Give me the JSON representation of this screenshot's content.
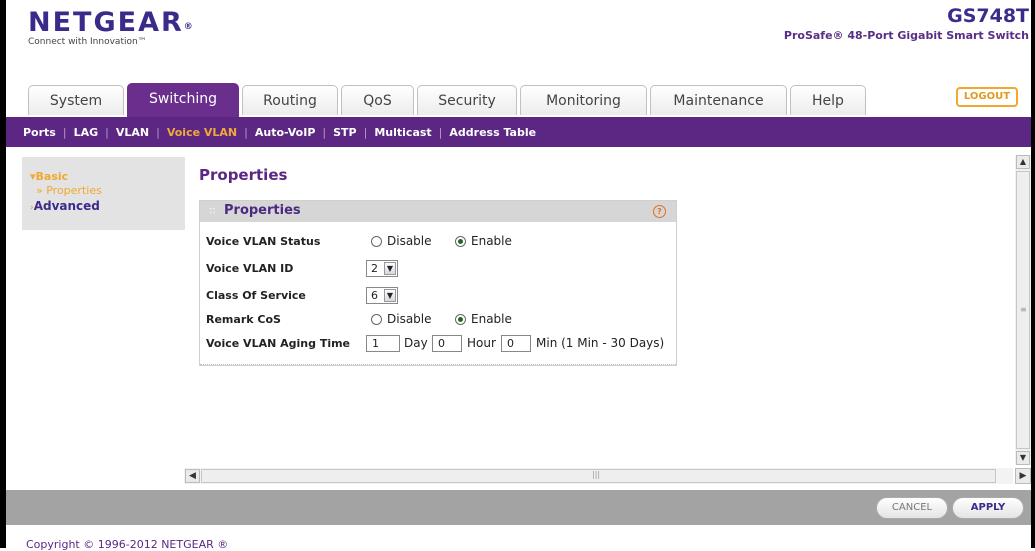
{
  "brand": {
    "logo": "NETGEAR",
    "logo_mark": "®",
    "tagline": "Connect with Innovation™"
  },
  "model": {
    "name": "GS748T",
    "description": "ProSafe® 48-Port Gigabit Smart Switch"
  },
  "tabs": [
    {
      "label": "System",
      "active": false
    },
    {
      "label": "Switching",
      "active": true
    },
    {
      "label": "Routing",
      "active": false
    },
    {
      "label": "QoS",
      "active": false
    },
    {
      "label": "Security",
      "active": false
    },
    {
      "label": "Monitoring",
      "active": false
    },
    {
      "label": "Maintenance",
      "active": false
    },
    {
      "label": "Help",
      "active": false
    }
  ],
  "logout_label": "LOGOUT",
  "subnav": [
    {
      "label": "Ports",
      "active": false
    },
    {
      "label": "LAG",
      "active": false
    },
    {
      "label": "VLAN",
      "active": false
    },
    {
      "label": "Voice VLAN",
      "active": true
    },
    {
      "label": "Auto-VoIP",
      "active": false
    },
    {
      "label": "STP",
      "active": false
    },
    {
      "label": "Multicast",
      "active": false
    },
    {
      "label": "Address Table",
      "active": false
    }
  ],
  "sidebar": {
    "basic": "Basic",
    "properties": "» Properties",
    "advanced": "Advanced"
  },
  "page_title": "Properties",
  "panel": {
    "dots": "::",
    "title": "Properties",
    "help": "?",
    "voice_vlan_status": {
      "label": "Voice VLAN Status",
      "options": [
        "Disable",
        "Enable"
      ],
      "selected": "Enable"
    },
    "voice_vlan_id": {
      "label": "Voice VLAN ID",
      "value": "2"
    },
    "class_of_service": {
      "label": "Class Of Service",
      "value": "6"
    },
    "remark_cos": {
      "label": "Remark CoS",
      "options": [
        "Disable",
        "Enable"
      ],
      "selected": "Enable"
    },
    "aging_time": {
      "label": "Voice VLAN Aging Time",
      "day_value": "1",
      "day_unit": "Day",
      "hour_value": "0",
      "hour_unit": "Hour",
      "min_value": "0",
      "min_unit": "Min (1 Min - 30 Days)"
    }
  },
  "buttons": {
    "cancel": "CANCEL",
    "apply": "APPLY"
  },
  "copyright": "Copyright © 1996-2012 NETGEAR ®",
  "colors": {
    "primary_purple": "#5c2683",
    "accent_orange": "#f0a830",
    "footer_gray": "#a3a3a3"
  }
}
